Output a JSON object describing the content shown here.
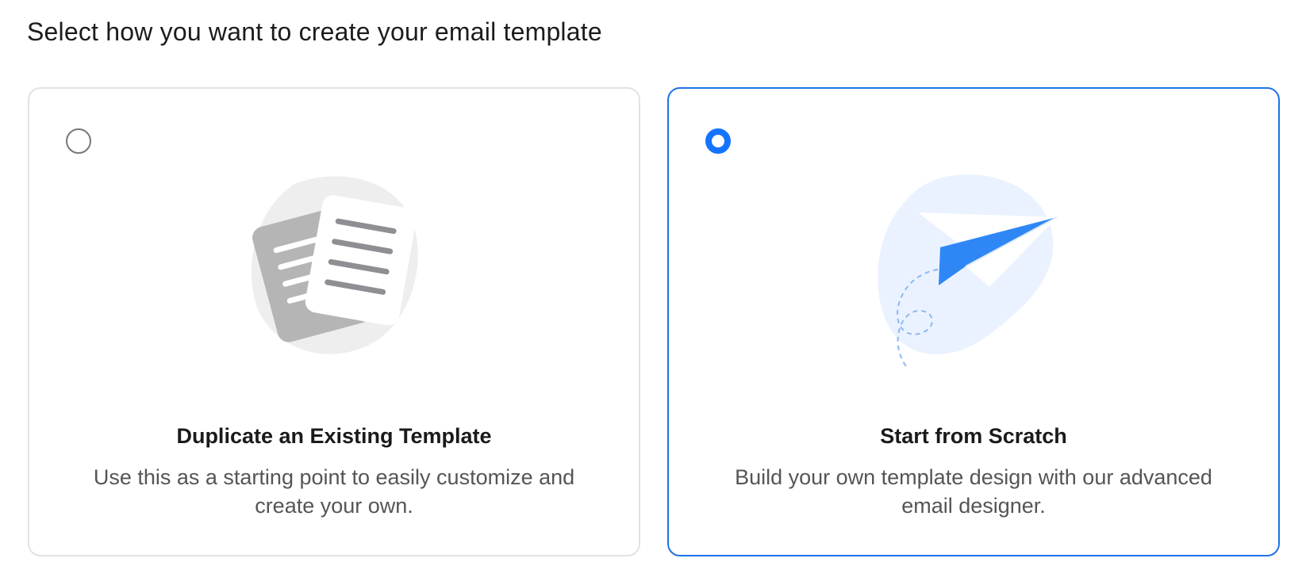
{
  "page": {
    "heading": "Select how you want to create your email template"
  },
  "options": [
    {
      "title": "Duplicate an Existing Template",
      "description": "Use this as a starting point to easily customize and create your own.",
      "selected": false,
      "icon": "duplicate-documents-icon"
    },
    {
      "title": "Start from Scratch",
      "description": "Build your own template design with our advanced email designer.",
      "selected": true,
      "icon": "paper-plane-icon"
    }
  ],
  "colors": {
    "accent": "#1574ff",
    "selected_border": "#1f73e6",
    "card_border": "#e2e2e2",
    "text_primary": "#1a1a1a",
    "text_secondary": "#555555"
  }
}
